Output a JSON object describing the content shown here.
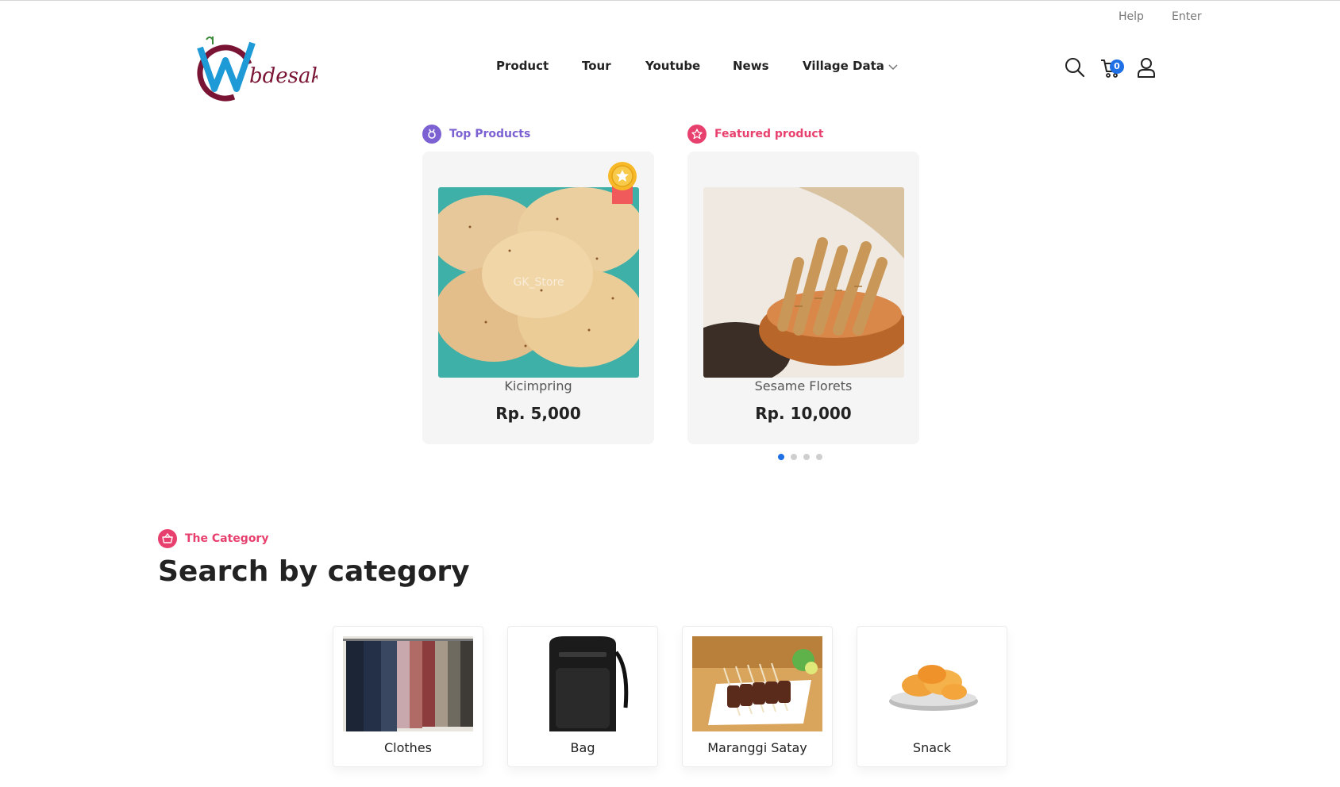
{
  "header": {
    "util_links": [
      "Help",
      "Enter"
    ],
    "logo_text": "Webdesaku",
    "nav": [
      "Product",
      "Tour",
      "Youtube",
      "News",
      "Village Data"
    ],
    "cart_count": "0",
    "icons": [
      "search-icon",
      "cart-icon",
      "user-icon"
    ]
  },
  "highlights": [
    {
      "tag": "Top Products",
      "tag_color": "#7b61d1",
      "name": "Kicimpring",
      "price": "Rp. 5,000",
      "watermark": "GK_Store"
    },
    {
      "tag": "Featured product",
      "tag_color": "#e8406e",
      "name": "Sesame Florets",
      "price": "Rp. 10,000"
    }
  ],
  "carousel": {
    "pages": 4,
    "active": 1
  },
  "category": {
    "tag": "The Category",
    "tag_color": "#e8406e",
    "title": "Search by category",
    "items": [
      "Clothes",
      "Bag",
      "Maranggi Satay",
      "Snack"
    ]
  },
  "colors": {
    "accent": "#1f6fe5",
    "pink": "#e8406e",
    "purple": "#7b61d1"
  }
}
